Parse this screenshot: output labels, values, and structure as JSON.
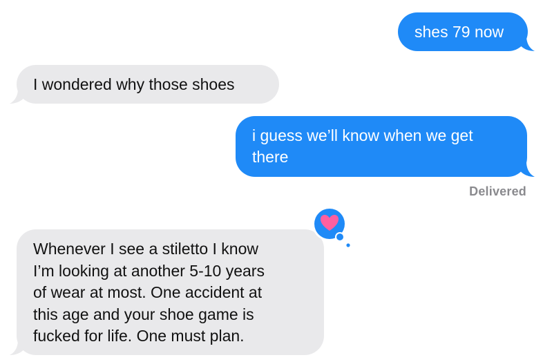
{
  "messages": [
    {
      "direction": "sent",
      "text": "shes 79 now"
    },
    {
      "direction": "received",
      "text": "I wondered why those shoes"
    },
    {
      "direction": "sent",
      "text": "i guess we’ll know when we get\nthere"
    },
    {
      "direction": "received",
      "text": "Whenever I see a stiletto I know\nI’m looking at another 5-10 years\nof wear at most.  One accident at\nthis age and your shoe game is\nfucked for life.  One must plan."
    }
  ],
  "status": {
    "delivered": "Delivered"
  },
  "tapback": {
    "icon": "heart-icon",
    "reaction": "love"
  },
  "colors": {
    "sent_bubble": "#1f8af7",
    "received_bubble": "#e9e9eb",
    "tapback_heart": "#ff5fa0"
  }
}
